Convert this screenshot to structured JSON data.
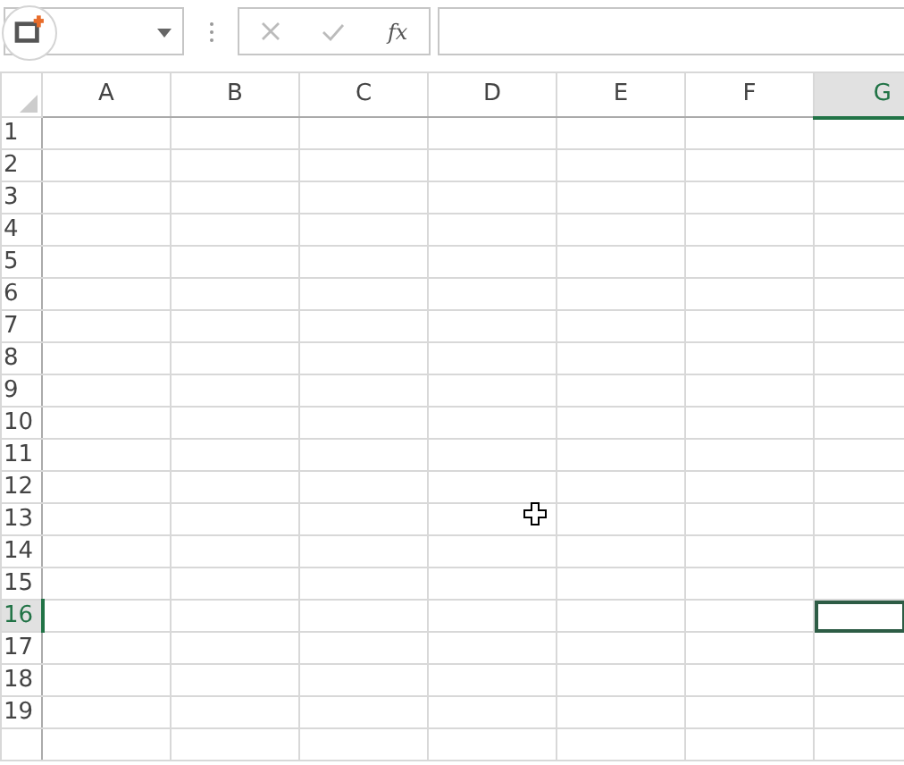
{
  "formula_bar": {
    "function_label": "fx"
  },
  "columns": [
    {
      "label": "A",
      "selected": false
    },
    {
      "label": "B",
      "selected": false
    },
    {
      "label": "C",
      "selected": false
    },
    {
      "label": "D",
      "selected": false
    },
    {
      "label": "E",
      "selected": false
    },
    {
      "label": "F",
      "selected": false
    },
    {
      "label": "G",
      "selected": true
    }
  ],
  "rows": [
    {
      "label": "1",
      "selected": false
    },
    {
      "label": "2",
      "selected": false
    },
    {
      "label": "3",
      "selected": false
    },
    {
      "label": "4",
      "selected": false
    },
    {
      "label": "5",
      "selected": false
    },
    {
      "label": "6",
      "selected": false
    },
    {
      "label": "7",
      "selected": false
    },
    {
      "label": "8",
      "selected": false
    },
    {
      "label": "9",
      "selected": false
    },
    {
      "label": "10",
      "selected": false
    },
    {
      "label": "11",
      "selected": false
    },
    {
      "label": "12",
      "selected": false
    },
    {
      "label": "13",
      "selected": false
    },
    {
      "label": "14",
      "selected": false
    },
    {
      "label": "15",
      "selected": false
    },
    {
      "label": "16",
      "selected": true
    },
    {
      "label": "17",
      "selected": false
    },
    {
      "label": "18",
      "selected": false
    },
    {
      "label": "19",
      "selected": false
    }
  ]
}
